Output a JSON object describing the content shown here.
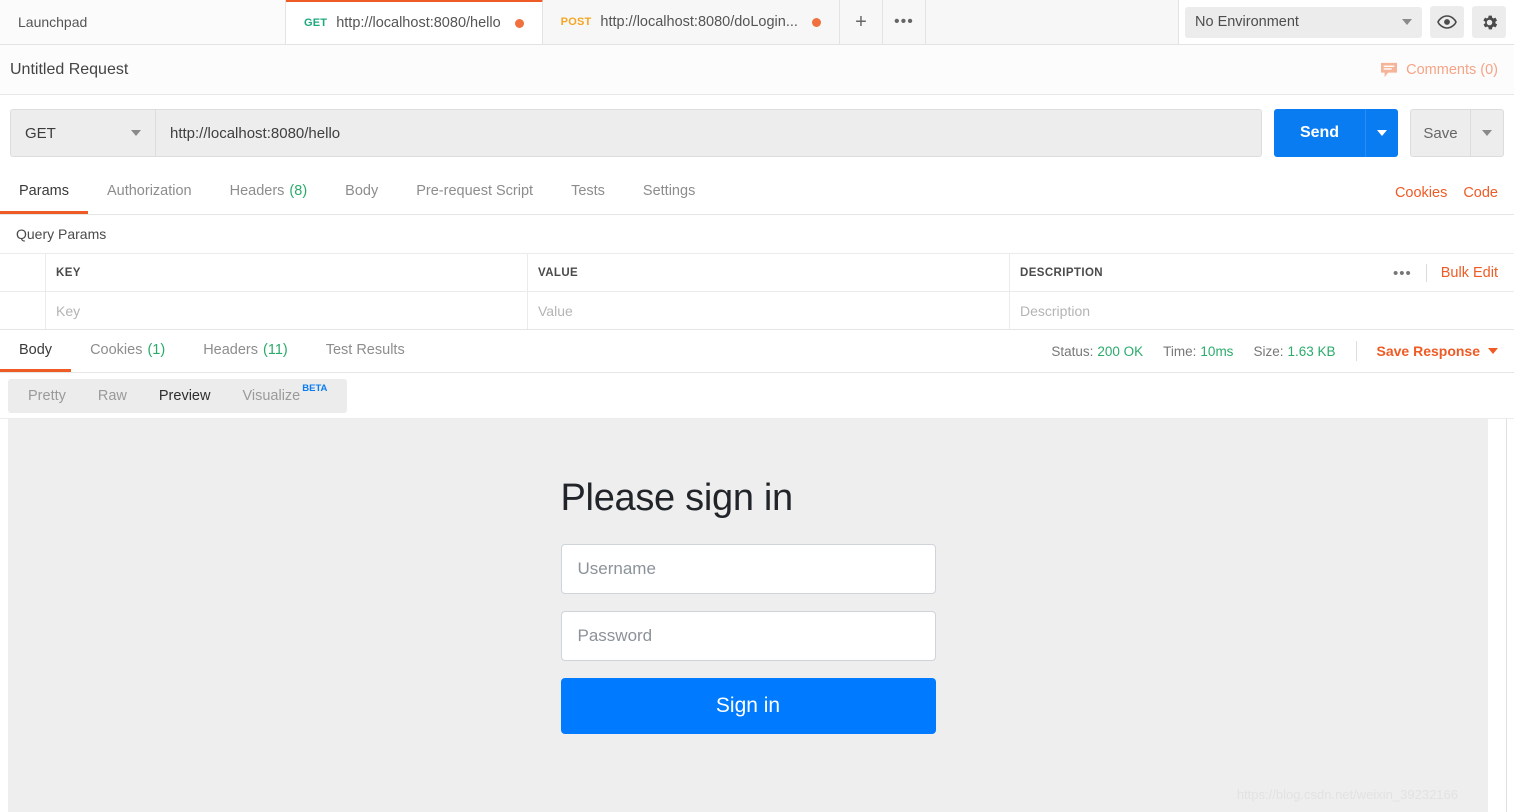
{
  "tabbar": {
    "launchpad_label": "Launchpad",
    "tabs": [
      {
        "method": "GET",
        "url": "http://localhost:8080/hello",
        "active": true
      },
      {
        "method": "POST",
        "url": "http://localhost:8080/doLogin...",
        "active": false
      }
    ],
    "new_tab_label": "+",
    "more_label": "•••"
  },
  "environment": {
    "selected": "No Environment",
    "eye_icon": "eye-icon",
    "gear_icon": "gear-icon"
  },
  "request_header": {
    "title": "Untitled Request",
    "comments_label": "Comments (0)"
  },
  "url_bar": {
    "method": "GET",
    "url": "http://localhost:8080/hello",
    "send_label": "Send",
    "save_label": "Save"
  },
  "request_tabs": {
    "items": [
      {
        "label": "Params",
        "count": "",
        "active": true
      },
      {
        "label": "Authorization",
        "count": "",
        "active": false
      },
      {
        "label": "Headers",
        "count": "(8)",
        "active": false
      },
      {
        "label": "Body",
        "count": "",
        "active": false
      },
      {
        "label": "Pre-request Script",
        "count": "",
        "active": false
      },
      {
        "label": "Tests",
        "count": "",
        "active": false
      },
      {
        "label": "Settings",
        "count": "",
        "active": false
      }
    ],
    "cookies_label": "Cookies",
    "code_label": "Code"
  },
  "query_params": {
    "section_label": "Query Params",
    "columns": [
      "KEY",
      "VALUE",
      "DESCRIPTION"
    ],
    "rows": [
      {
        "key": "Key",
        "value": "Value",
        "description": "Description"
      }
    ],
    "more_label": "•••",
    "bulk_edit_label": "Bulk Edit"
  },
  "response_tabs": {
    "items": [
      {
        "label": "Body",
        "count": "",
        "active": true
      },
      {
        "label": "Cookies",
        "count": "(1)",
        "active": false
      },
      {
        "label": "Headers",
        "count": "(11)",
        "active": false
      },
      {
        "label": "Test Results",
        "count": "",
        "active": false
      }
    ],
    "status_label": "Status:",
    "status_value": "200 OK",
    "time_label": "Time:",
    "time_value": "10ms",
    "size_label": "Size:",
    "size_value": "1.63 KB",
    "save_response_label": "Save Response"
  },
  "view_modes": {
    "items": [
      {
        "label": "Pretty",
        "active": false
      },
      {
        "label": "Raw",
        "active": false
      },
      {
        "label": "Preview",
        "active": true
      },
      {
        "label": "Visualize",
        "active": false,
        "badge": "BETA"
      }
    ]
  },
  "preview_body": {
    "heading": "Please sign in",
    "username_placeholder": "Username",
    "password_placeholder": "Password",
    "signin_button": "Sign in"
  },
  "watermark": "https://blog.csdn.net/weixin_39232166",
  "colors": {
    "accent_orange": "#ef5b25",
    "send_blue": "#0a7cf1",
    "status_green": "#2bab6b",
    "method_get": "#1ea97c",
    "method_post": "#f5a623",
    "preview_bg": "#eeeeee",
    "signin_blue": "#007bff"
  }
}
